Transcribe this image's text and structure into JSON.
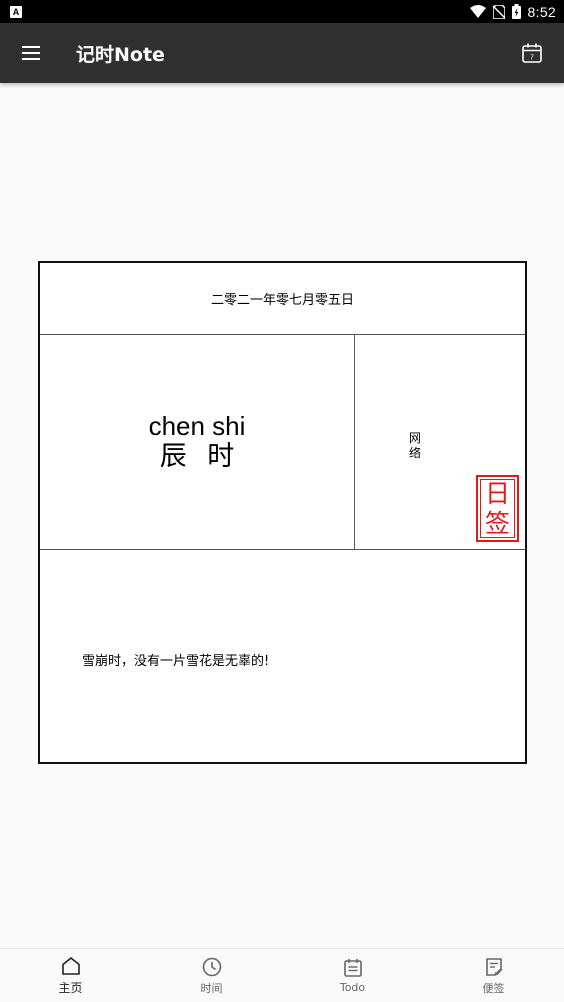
{
  "status_bar": {
    "notification_glyph": "A",
    "time": "8:52"
  },
  "app_bar": {
    "title": "记时Note",
    "calendar_day": "7"
  },
  "card": {
    "date": "二零二一年零七月零五日",
    "pinyin": "chen shi",
    "hanzi": "辰 时",
    "category": "网络",
    "stamp_top": "日",
    "stamp_bottom": "签",
    "quote": "雪崩时，没有一片雪花是无辜的!"
  },
  "bottom_nav": {
    "items": [
      {
        "label": "主页",
        "icon": "home-icon",
        "active": true
      },
      {
        "label": "时间",
        "icon": "clock-icon",
        "active": false
      },
      {
        "label": "Todo",
        "icon": "todo-icon",
        "active": false
      },
      {
        "label": "便签",
        "icon": "note-icon",
        "active": false
      }
    ]
  },
  "colors": {
    "app_bar": "#303030",
    "stamp": "#e01919",
    "background": "#fafafa"
  }
}
